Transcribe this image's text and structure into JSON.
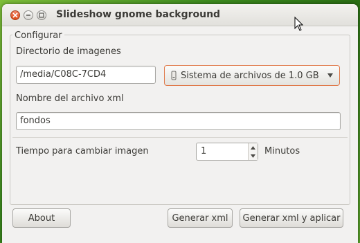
{
  "window": {
    "title": "Slideshow gnome background"
  },
  "frame": {
    "label": "Configurar"
  },
  "directory": {
    "label": "Directorio de imagenes",
    "value": "/media/C08C-7CD4",
    "combo_value": "Sistema de archivos de 1.0 GB"
  },
  "xml_name": {
    "label": "Nombre del archivo xml",
    "value": "fondos"
  },
  "interval": {
    "label": "Tiempo para cambiar imagen",
    "value": "1",
    "unit": "Minutos"
  },
  "buttons": {
    "about": "About",
    "generate": "Generar xml",
    "generate_apply": "Generar xml y aplicar"
  },
  "colors": {
    "close_button": "#dd4814",
    "combo_focus_border": "#e07a4b",
    "window_bg": "#f2f1f0"
  }
}
